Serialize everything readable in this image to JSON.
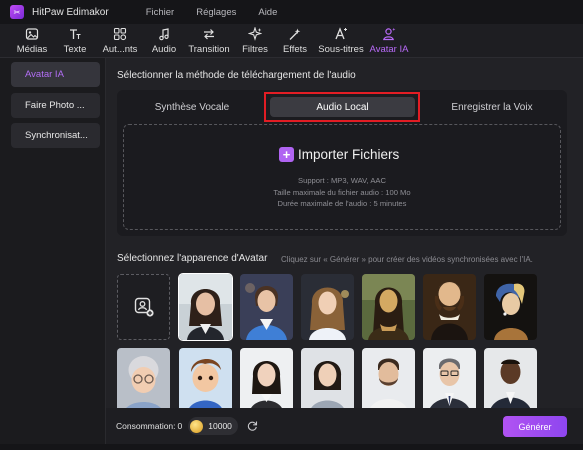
{
  "app": {
    "name": "HitPaw Edimakor",
    "logo_glyph": "✂"
  },
  "menu": [
    "Fichier",
    "Réglages",
    "Aide"
  ],
  "toolbar": [
    {
      "label": "Médias",
      "icon": "media-icon"
    },
    {
      "label": "Texte",
      "icon": "text-icon"
    },
    {
      "label": "Aut...nts",
      "icon": "elements-icon"
    },
    {
      "label": "Audio",
      "icon": "audio-icon"
    },
    {
      "label": "Transition",
      "icon": "transition-icon"
    },
    {
      "label": "Filtres",
      "icon": "filters-icon"
    },
    {
      "label": "Effets",
      "icon": "effects-icon"
    },
    {
      "label": "Sous-titres",
      "icon": "subtitles-icon"
    },
    {
      "label": "Avatar IA",
      "icon": "avatar-ai-icon",
      "active": true
    }
  ],
  "sidebar": [
    {
      "label": "Avatar IA",
      "active": true
    },
    {
      "label": "Faire Photo ..."
    },
    {
      "label": "Synchronisat..."
    }
  ],
  "audio_method": {
    "title": "Sélectionner la méthode de téléchargement de l'audio",
    "tabs": [
      "Synthèse Vocale",
      "Audio Local",
      "Enregistrer la Voix"
    ],
    "selected_tab": "Audio Local",
    "import_label": "Importer Fichiers",
    "support": "Support : MP3, WAV, AAC",
    "max_size": "Taille maximale du fichier audio : 100 Mo",
    "max_duration": "Durée maximale de l'audio : 5 minutes"
  },
  "avatar_section": {
    "title": "Sélectionnez l'apparence d'Avatar",
    "hint": "Cliquez sur « Générer » pour créer des vidéos synchronisées avec l'IA."
  },
  "footer": {
    "consumption_label": "Consommation:",
    "consumption_value": "0",
    "coins": "10000",
    "generate_label": "Générer"
  },
  "colors": {
    "accent": "#b26ef5",
    "highlight_frame": "#e21d24"
  }
}
